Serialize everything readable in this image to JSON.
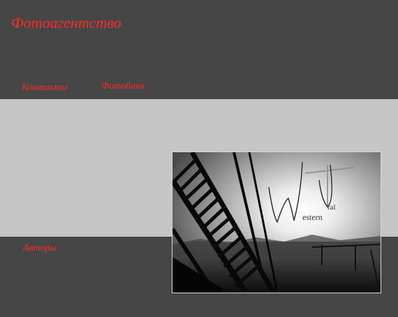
{
  "header": {
    "title": "Фотоагентство"
  },
  "nav": {
    "contacts": "Контакты",
    "photobank": "Фотобанк",
    "authors": "Авторы"
  },
  "photo": {
    "logo_text": "WUral Western",
    "logo_western": "estern",
    "logo_ral": "ral"
  },
  "colors": {
    "background_dark": "#464646",
    "band_light": "#c6c6c6",
    "accent_red": "#ff2a22"
  }
}
